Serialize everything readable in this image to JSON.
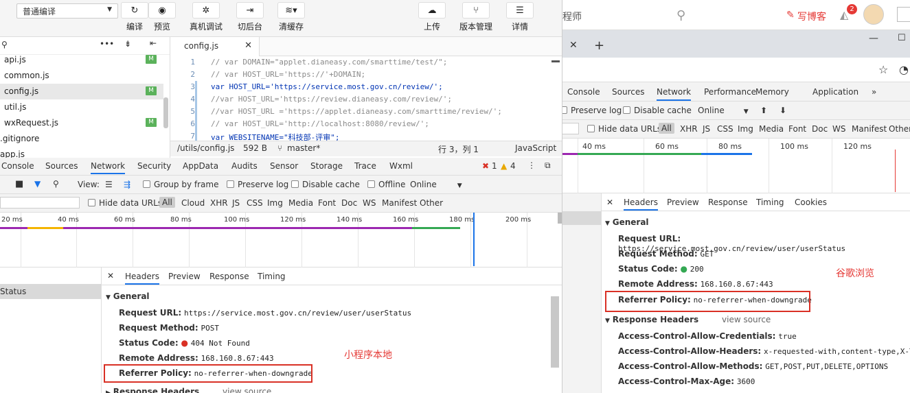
{
  "toolbar": {
    "compile_mode": "普通编译",
    "buttons": [
      {
        "label": "编译",
        "icon": "refresh-icon"
      },
      {
        "label": "预览",
        "icon": "eye-icon"
      },
      {
        "label": "真机调试",
        "icon": "bug-icon"
      },
      {
        "label": "切后台",
        "icon": "switch-background-icon"
      },
      {
        "label": "清缓存",
        "icon": "layers-icon"
      },
      {
        "label": "上传",
        "icon": "cloud-upload-icon"
      },
      {
        "label": "版本管理",
        "icon": "branch-icon"
      },
      {
        "label": "详情",
        "icon": "menu-icon"
      }
    ]
  },
  "files": [
    {
      "name": "api.js",
      "badge": "M"
    },
    {
      "name": "common.js",
      "badge": ""
    },
    {
      "name": "config.js",
      "badge": "M"
    },
    {
      "name": "util.js",
      "badge": ""
    },
    {
      "name": "wxRequest.js",
      "badge": "M"
    },
    {
      "name": ".gitignore",
      "badge": ""
    },
    {
      "name": "app.js",
      "badge": ""
    }
  ],
  "editor": {
    "tab": "config.js",
    "lines": [
      {
        "n": "1",
        "text": "// var DOMAIN=\"applet.dianeasy.com/smarttime/test/\";"
      },
      {
        "n": "2",
        "text": "// var HOST_URL='https://'+DOMAIN;"
      },
      {
        "n": "3",
        "text": "var HOST_URL='https://service.most.gov.cn/review/';"
      },
      {
        "n": "4",
        "text": "//var HOST_URL='https://review.dianeasy.com/review/';"
      },
      {
        "n": "5",
        "text": "//var HOST_URL ='https://applet.dianeasy.com/smarttime/review/';"
      },
      {
        "n": "6",
        "text": "// var HOST_URL='http://localhost:8080/review/';"
      },
      {
        "n": "7",
        "text": "var WEBSITENAME=\"科技部-评审\";"
      }
    ],
    "status_path": "/utils/config.js",
    "status_size": "592 B",
    "status_branch": "master*",
    "status_pos": "行 3，列 1",
    "status_lang": "JavaScript"
  },
  "devtools": {
    "tabs": [
      "Console",
      "Sources",
      "Network",
      "Security",
      "AppData",
      "Audits",
      "Sensor",
      "Storage",
      "Trace",
      "Wxml"
    ],
    "errors": "1",
    "warnings": "4",
    "view_label": "View:",
    "group_by_frame": "Group by frame",
    "preserve_log": "Preserve log",
    "disable_cache": "Disable cache",
    "offline": "Offline",
    "online": "Online",
    "hide_data_urls": "Hide data URLs",
    "filters": [
      "All",
      "Cloud",
      "XHR",
      "JS",
      "CSS",
      "Img",
      "Media",
      "Font",
      "Doc",
      "WS",
      "Manifest",
      "Other"
    ],
    "ticks": [
      "20 ms",
      "40 ms",
      "60 ms",
      "80 ms",
      "100 ms",
      "120 ms",
      "140 ms",
      "160 ms",
      "180 ms",
      "200 ms"
    ],
    "request_name": "Status",
    "detail_tabs": [
      "Headers",
      "Preview",
      "Response",
      "Timing"
    ],
    "general": "General",
    "request_url_label": "Request URL:",
    "request_url": "https://service.most.gov.cn/review/user/userStatus",
    "method_label": "Request Method:",
    "method": "POST",
    "status_label": "Status Code:",
    "status": "404 Not Found",
    "remote_label": "Remote Address:",
    "remote": "168.160.8.67:443",
    "referrer_label": "Referrer Policy:",
    "referrer": "no-referrer-when-downgrade",
    "response_headers": "Response Headers",
    "view_source": "view source",
    "annotation": "小程序本地"
  },
  "chrome": {
    "search_partial": "程师",
    "write_blog": "写博客",
    "notif_count": "2",
    "devtools_tabs": [
      "Console",
      "Sources",
      "Network",
      "Performance",
      "Memory",
      "Application"
    ],
    "preserve_log": "Preserve log",
    "disable_cache": "Disable cache",
    "online": "Online",
    "hide_data_urls": "Hide data URLs",
    "filters": [
      "All",
      "XHR",
      "JS",
      "CSS",
      "Img",
      "Media",
      "Font",
      "Doc",
      "WS",
      "Manifest",
      "Other"
    ],
    "ticks": [
      "40 ms",
      "60 ms",
      "80 ms",
      "100 ms",
      "120 ms"
    ],
    "detail_tabs": [
      "Headers",
      "Preview",
      "Response",
      "Timing",
      "Cookies"
    ],
    "general": "General",
    "request_url_label": "Request URL:",
    "request_url": "https://service.most.gov.cn/review/user/userStatus",
    "method_label": "Request Method:",
    "method": "GET",
    "status_label": "Status Code:",
    "status": "200",
    "remote_label": "Remote Address:",
    "remote": "168.160.8.67:443",
    "referrer_label": "Referrer Policy:",
    "referrer": "no-referrer-when-downgrade",
    "response_headers": "Response Headers",
    "view_source": "view source",
    "h1_label": "Access-Control-Allow-Credentials:",
    "h1": "true",
    "h2_label": "Access-Control-Allow-Headers:",
    "h2": "x-requested-with,content-type,X-Token",
    "h3_label": "Access-Control-Allow-Methods:",
    "h3": "GET,POST,PUT,DELETE,OPTIONS",
    "h4_label": "Access-Control-Max-Age:",
    "h4": "3600",
    "annotation": "谷歌浏览"
  }
}
